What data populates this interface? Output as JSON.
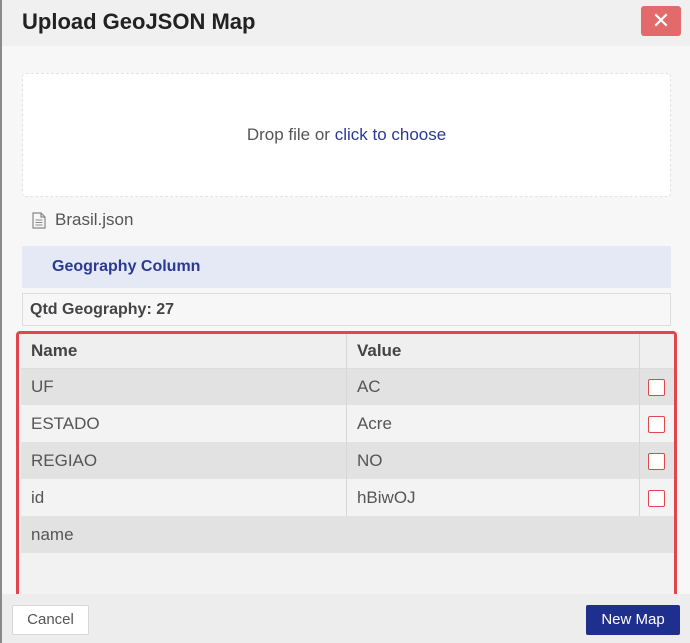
{
  "dialog": {
    "title": "Upload GeoJSON Map",
    "close_label": "✕"
  },
  "dropzone": {
    "prefix": "Drop file or ",
    "link": "click to choose"
  },
  "file": {
    "name": "Brasil.json"
  },
  "geography_column": {
    "label": "Geography Column"
  },
  "qtd": {
    "label": "Qtd Geography: 27"
  },
  "table": {
    "headers": [
      "Name",
      "Value"
    ],
    "rows": [
      {
        "name": "UF",
        "value": "AC",
        "checked": false
      },
      {
        "name": "ESTADO",
        "value": "Acre",
        "checked": false
      },
      {
        "name": "REGIAO",
        "value": "NO",
        "checked": false
      },
      {
        "name": "id",
        "value": "hBiwOJ",
        "checked": false
      },
      {
        "name": "name",
        "value": "",
        "checked": false
      }
    ]
  },
  "footer": {
    "cancel_label": "Cancel",
    "new_map_label": "New Map"
  },
  "colors": {
    "accent": "#1f2f8e",
    "highlight": "#e0464b",
    "close": "#e26a6a"
  }
}
